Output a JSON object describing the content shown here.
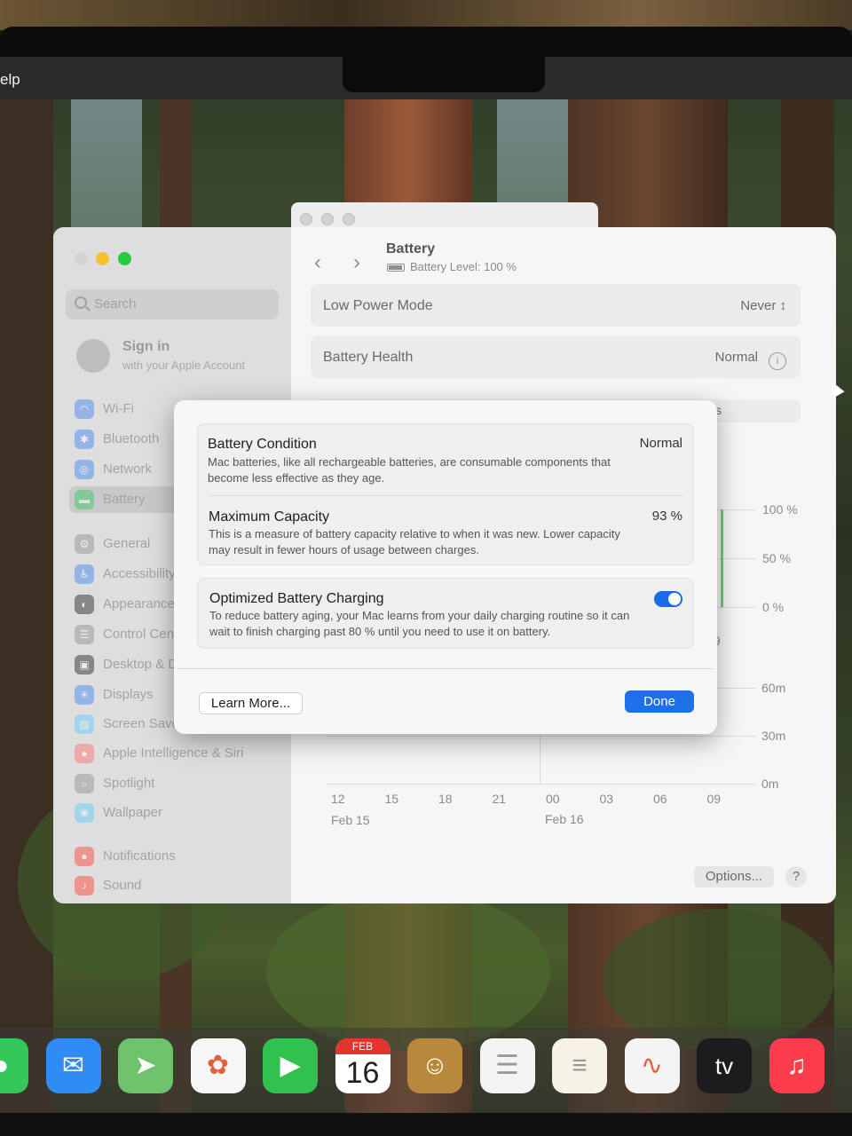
{
  "menubar": {
    "help": "Help"
  },
  "settings": {
    "search_placeholder": "Search",
    "signin": {
      "title": "Sign in",
      "subtitle": "with your Apple Account"
    },
    "sidebar": [
      {
        "label": "Wi-Fi",
        "icon": "wifi-icon",
        "color": "#3b82f6"
      },
      {
        "label": "Bluetooth",
        "icon": "bluetooth-icon",
        "color": "#3b82f6"
      },
      {
        "label": "Network",
        "icon": "globe-icon",
        "color": "#3b82f6"
      },
      {
        "label": "Battery",
        "icon": "battery-icon",
        "color": "#34c759"
      },
      {
        "label": "General",
        "icon": "gear-icon",
        "color": "#8e8e93"
      },
      {
        "label": "Accessibility",
        "icon": "accessibility-icon",
        "color": "#3b82f6"
      },
      {
        "label": "Appearance",
        "icon": "appearance-icon",
        "color": "#1c1c1e"
      },
      {
        "label": "Control Centre",
        "icon": "control-centre-icon",
        "color": "#8e8e93"
      },
      {
        "label": "Desktop & Dock",
        "icon": "desktop-icon",
        "color": "#1c1c1e"
      },
      {
        "label": "Displays",
        "icon": "displays-icon",
        "color": "#3b82f6"
      },
      {
        "label": "Screen Saver",
        "icon": "screen-saver-icon",
        "color": "#5ac8fa"
      },
      {
        "label": "Apple Intelligence & Siri",
        "icon": "siri-icon",
        "color": "#ff6b6b"
      },
      {
        "label": "Spotlight",
        "icon": "spotlight-icon",
        "color": "#8e8e93"
      },
      {
        "label": "Wallpaper",
        "icon": "wallpaper-icon",
        "color": "#5ac8fa"
      },
      {
        "label": "Notifications",
        "icon": "notifications-icon",
        "color": "#ff3b30"
      },
      {
        "label": "Sound",
        "icon": "sound-icon",
        "color": "#ff3b30"
      }
    ],
    "page": {
      "title": "Battery",
      "subtitle": "Battery Level: 100 %",
      "rows": [
        {
          "label": "Low Power Mode",
          "value": "Never"
        },
        {
          "label": "Battery Health",
          "value": "Normal"
        }
      ],
      "chart": {
        "level_ticks": [
          "100 %",
          "50 %",
          "0 %"
        ],
        "usage_ticks": [
          "60m",
          "30m",
          "0m"
        ],
        "x_ticks": [
          "12",
          "15",
          "18",
          "21",
          "00",
          "03",
          "06",
          "09"
        ],
        "date_labels": [
          "Feb 15",
          "Feb 16"
        ],
        "partial_tab": "s",
        "partial_hour": "9"
      },
      "options_label": "Options...",
      "help_label": "?"
    }
  },
  "dialog": {
    "condition": {
      "title": "Battery Condition",
      "value": "Normal",
      "description": "Mac batteries, like all rechargeable batteries, are consumable components that become less effective as they age."
    },
    "capacity": {
      "title": "Maximum Capacity",
      "value": "93 %",
      "description": "This is a measure of battery capacity relative to when it was new. Lower capacity may result in fewer hours of usage between charges."
    },
    "optimized": {
      "title": "Optimized Battery Charging",
      "enabled": true,
      "description": "To reduce battery aging, your Mac learns from your daily charging routine so it can wait to finish charging past 80 % until you need to use it on battery."
    },
    "learn_more": "Learn More...",
    "done": "Done"
  },
  "dock": {
    "calendar": {
      "month": "FEB",
      "day": "16"
    },
    "tv": "tv",
    "apps": [
      {
        "name": "messages-icon",
        "color": "#34c759"
      },
      {
        "name": "mail-icon",
        "color": "#2f8cf5"
      },
      {
        "name": "maps-icon",
        "color": "#6dc26b"
      },
      {
        "name": "photos-icon",
        "color": "#f7f7f7"
      },
      {
        "name": "facetime-icon",
        "color": "#30c14e"
      },
      {
        "name": "calendar-icon",
        "color": "#ffffff"
      },
      {
        "name": "contacts-icon",
        "color": "#b8893d"
      },
      {
        "name": "reminders-icon",
        "color": "#f4f4f4"
      },
      {
        "name": "notes-icon",
        "color": "#f6f3e6"
      },
      {
        "name": "freeform-icon",
        "color": "#f4f4f4"
      },
      {
        "name": "tv-icon",
        "color": "#1c1c1e"
      },
      {
        "name": "music-icon",
        "color": "#fa3c4c"
      }
    ]
  }
}
